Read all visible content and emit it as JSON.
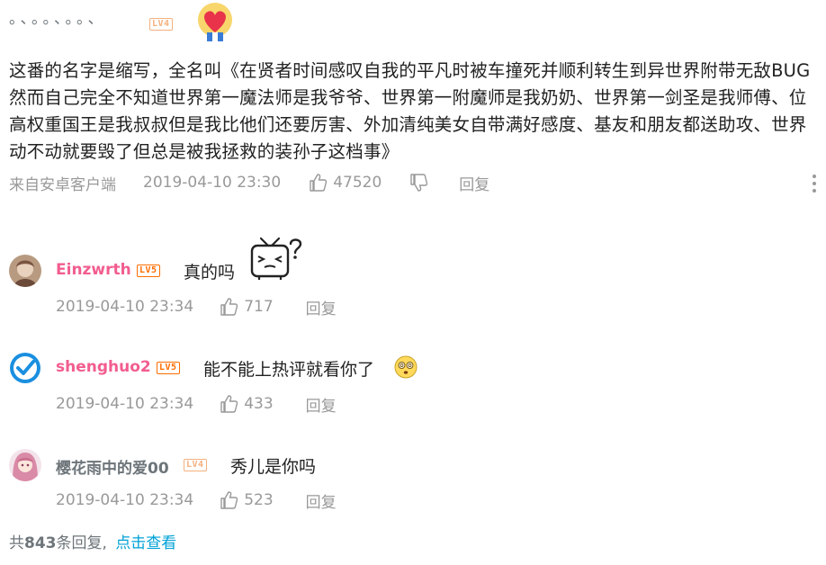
{
  "root_comment": {
    "username": "。、。。、。。、",
    "level": "LV4",
    "level_color": "#f4b07e",
    "text": "这番的名字是缩写，全名叫《在贤者时间感叹自我的平凡时被车撞死并顺利转生到异世界附带无敌BUG然而自己完全不知道世界第一魔法师是我爷爷、世界第一附魔师是我奶奶、世界第一剑圣是我师傅、位高权重国王是我叔叔但是我比他们还要厉害、外加清纯美女自带满好感度、基友和朋友都送助攻、世界动不动就要毁了但总是被我拯救的装孙子这档事》",
    "source": "来自安卓客户端",
    "time": "2019-04-10 23:30",
    "likes": "47520",
    "reply_label": "回复"
  },
  "replies": [
    {
      "username": "Einzwrth",
      "level": "LV5",
      "level_color": "#ff6c00",
      "text": "真的吗",
      "time": "2019-04-10 23:34",
      "likes": "717",
      "reply_label": "回复",
      "emoji": "tv-question-emoji"
    },
    {
      "username": "shenghuo2",
      "level": "LV5",
      "level_color": "#ff6c00",
      "text": "能不能上热评就看你了",
      "time": "2019-04-10 23:34",
      "likes": "433",
      "reply_label": "回复",
      "emoji": "dizzy-face-emoji"
    },
    {
      "username": "樱花雨中的爱00",
      "level": "LV4",
      "level_color": "#f4b07e",
      "text": "秀儿是你吗",
      "time": "2019-04-10 23:34",
      "likes": "523",
      "reply_label": "回复"
    }
  ],
  "footer": {
    "prefix": "共",
    "count": "843",
    "suffix": "条回复,",
    "view_link": "点击查看"
  },
  "colors": {
    "username_pink": "#f25d8e",
    "username_gray": "#6d757a",
    "meta_gray": "#999999",
    "link_blue": "#00a1d6"
  }
}
